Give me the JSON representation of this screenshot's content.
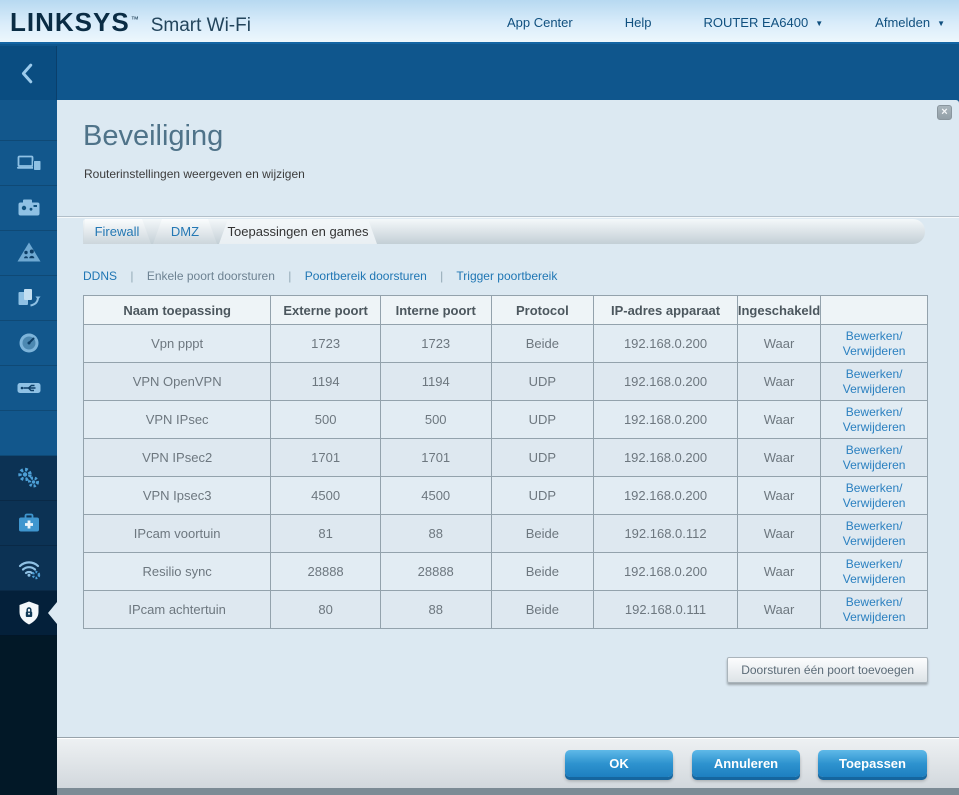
{
  "header": {
    "logo": "LINKSYS",
    "logo_tm": "™",
    "product": "Smart Wi-Fi",
    "dropdown_icon": "▼",
    "nav": [
      {
        "label": "App Center",
        "has_dropdown": false
      },
      {
        "label": "Help",
        "has_dropdown": false
      },
      {
        "label": "ROUTER EA6400",
        "has_dropdown": true
      },
      {
        "label": "Afmelden",
        "has_dropdown": true
      }
    ]
  },
  "sidebar": {
    "back_icon": "chevron-left-icon",
    "icons": [
      "device-list-icon",
      "guest-access-icon",
      "parental-controls-icon",
      "media-prioritization-icon",
      "speed-test-icon",
      "external-storage-icon",
      "connectivity-icon",
      "troubleshooting-icon",
      "wireless-icon",
      "security-icon"
    ],
    "active_item": "security"
  },
  "panel": {
    "title": "Beveiliging",
    "subtitle": "Routerinstellingen weergeven en wijzigen",
    "close_icon": "×",
    "tabs": [
      {
        "label": "Firewall",
        "active": false
      },
      {
        "label": "DMZ",
        "active": false
      },
      {
        "label": "Toepassingen en games",
        "active": true
      }
    ],
    "subnav_separator": "|",
    "subnav": [
      {
        "label": "DDNS",
        "current": false
      },
      {
        "label": "Enkele poort doorsturen",
        "current": true
      },
      {
        "label": "Poortbereik doorsturen",
        "current": false
      },
      {
        "label": "Trigger poortbereik",
        "current": false
      }
    ],
    "table": {
      "headers": [
        "Naam toepassing",
        "Externe poort",
        "Interne poort",
        "Protocol",
        "IP-adres apparaat",
        "Ingeschakeld",
        ""
      ],
      "action_line1": "Bewerken/",
      "action_line2": "Verwijderen",
      "rows": [
        {
          "name": "Vpn pppt",
          "external": "1723",
          "internal": "1723",
          "protocol": "Beide",
          "ip": "192.168.0.200",
          "enabled": "Waar"
        },
        {
          "name": "VPN OpenVPN",
          "external": "1194",
          "internal": "1194",
          "protocol": "UDP",
          "ip": "192.168.0.200",
          "enabled": "Waar"
        },
        {
          "name": "VPN IPsec",
          "external": "500",
          "internal": "500",
          "protocol": "UDP",
          "ip": "192.168.0.200",
          "enabled": "Waar"
        },
        {
          "name": "VPN IPsec2",
          "external": "1701",
          "internal": "1701",
          "protocol": "UDP",
          "ip": "192.168.0.200",
          "enabled": "Waar"
        },
        {
          "name": "VPN Ipsec3",
          "external": "4500",
          "internal": "4500",
          "protocol": "UDP",
          "ip": "192.168.0.200",
          "enabled": "Waar"
        },
        {
          "name": "IPcam voortuin",
          "external": "81",
          "internal": "88",
          "protocol": "Beide",
          "ip": "192.168.0.112",
          "enabled": "Waar"
        },
        {
          "name": "Resilio sync",
          "external": "28888",
          "internal": "28888",
          "protocol": "Beide",
          "ip": "192.168.0.200",
          "enabled": "Waar"
        },
        {
          "name": "IPcam achtertuin",
          "external": "80",
          "internal": "88",
          "protocol": "Beide",
          "ip": "192.168.0.111",
          "enabled": "Waar"
        }
      ]
    },
    "add_button_label": "Doorsturen één poort toevoegen"
  },
  "footer": {
    "ok_label": "OK",
    "cancel_label": "Annuleren",
    "apply_label": "Toepassen"
  },
  "colors": {
    "header_navy": "#0a2c44",
    "band_blue": "#0f568d",
    "panel_bg": "#dce9f2",
    "link_blue": "#2076b4",
    "button_blue": "#2e93cf"
  }
}
